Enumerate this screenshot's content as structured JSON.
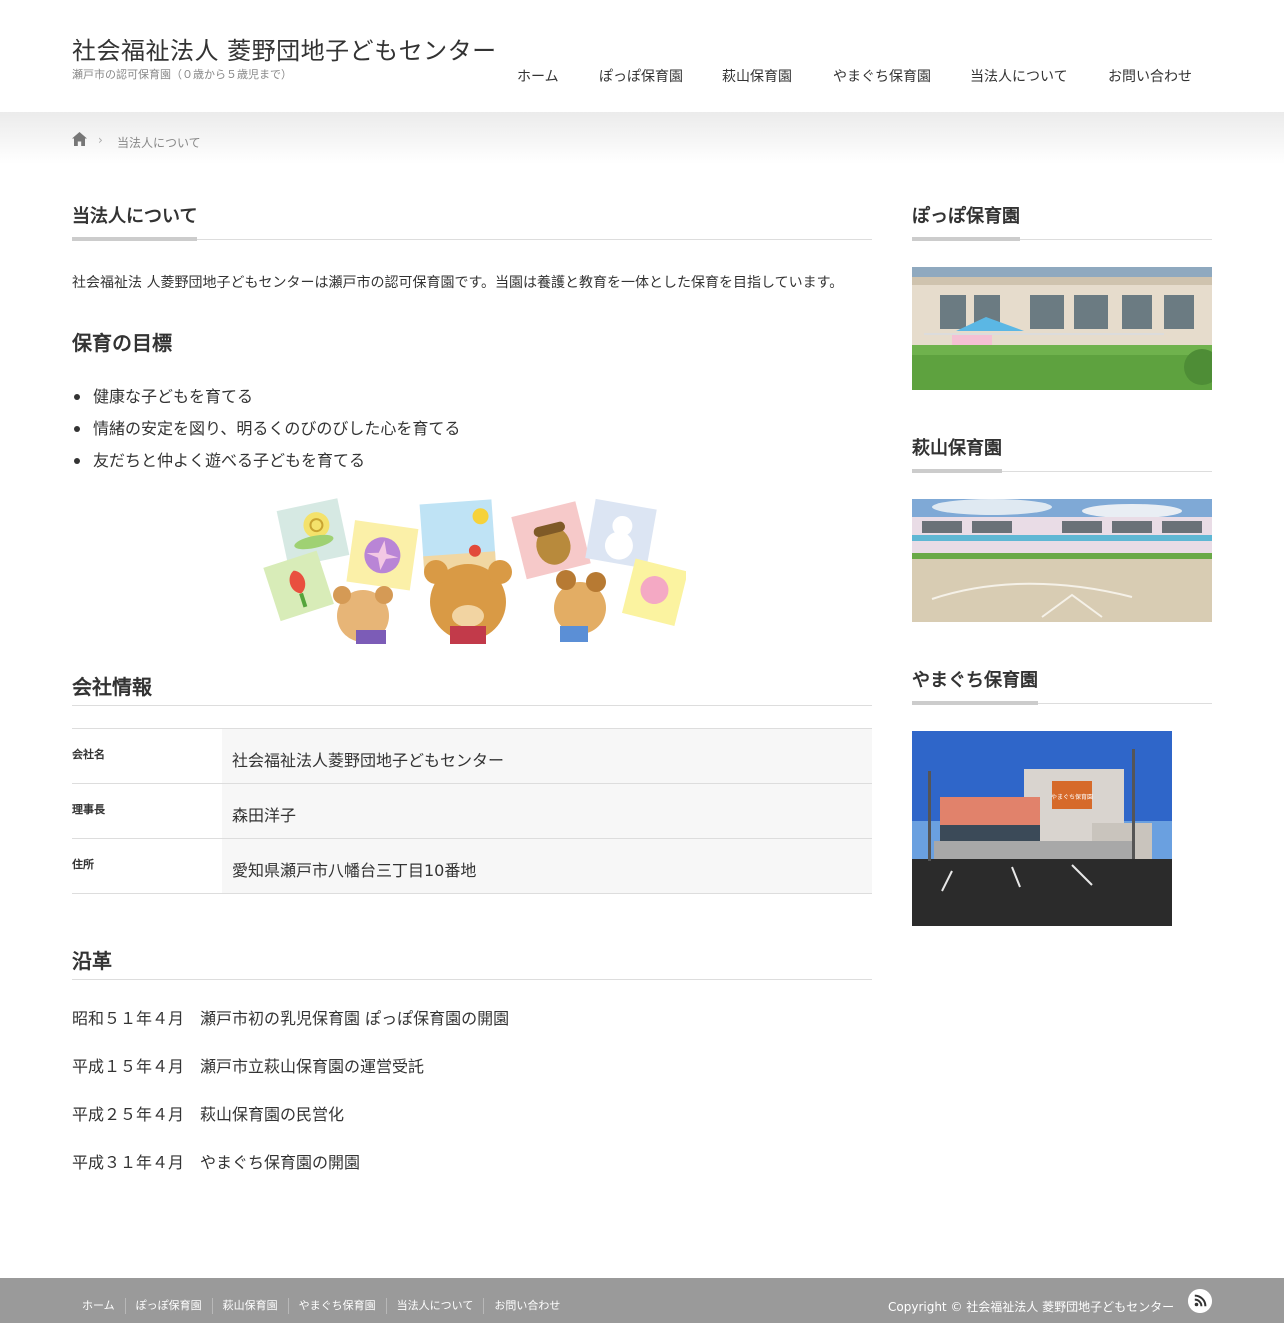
{
  "header": {
    "site_title": "社会福祉法人 菱野団地子どもセンター",
    "site_description": "瀬戸市の認可保育園（０歳から５歳児まで）",
    "nav": [
      "ホーム",
      "ぽっぽ保育園",
      "萩山保育園",
      "やまぐち保育園",
      "当法人について",
      "お問い合わせ"
    ]
  },
  "breadcrumb": {
    "home_icon": "home-icon",
    "separator": "›",
    "current": "当法人について"
  },
  "main": {
    "title": "当法人について",
    "intro": "社会福祉法 人菱野団地子どもセンターは瀬戸市の認可保育園です。当園は養護と教育を一体とした保育を目指しています。",
    "goals_heading": "保育の目標",
    "goals": [
      "健康な子どもを育てる",
      "情緒の安定を図り、明るくのびのびした心を育てる",
      "友だちと仲よく遊べる子どもを育てる"
    ],
    "company_heading": "会社情報",
    "company": [
      {
        "label": "会社名",
        "value": "社会福祉法人菱野団地子どもセンター"
      },
      {
        "label": "理事長",
        "value": "森田洋子"
      },
      {
        "label": "住所",
        "value": "愛知県瀬戸市八幡台三丁目10番地"
      }
    ],
    "history_heading": "沿革",
    "history": [
      "昭和５１年４月　瀬戸市初の乳児保育園 ぽっぽ保育園の開園",
      "平成１５年４月　瀬戸市立萩山保育園の運営受託",
      "平成２５年４月　萩山保育園の民営化",
      "平成３１年４月　やまぐち保育園の開園"
    ]
  },
  "sidebar": {
    "widgets": [
      {
        "title": "ぽっぽ保育園"
      },
      {
        "title": "萩山保育園"
      },
      {
        "title": "やまぐち保育園",
        "sign": "やまぐち保育園"
      }
    ]
  },
  "footer": {
    "nav": [
      "ホーム",
      "ぽっぽ保育園",
      "萩山保育園",
      "やまぐち保育園",
      "当法人について",
      "お問い合わせ"
    ],
    "copyright": "Copyright ©  社会福祉法人 菱野団地子どもセンター",
    "rss_icon": "rss-icon"
  },
  "colors": {
    "footer_bg": "#9a9a9a",
    "heading_underline": "#cccccc",
    "table_cell_bg": "#f7f7f7"
  }
}
